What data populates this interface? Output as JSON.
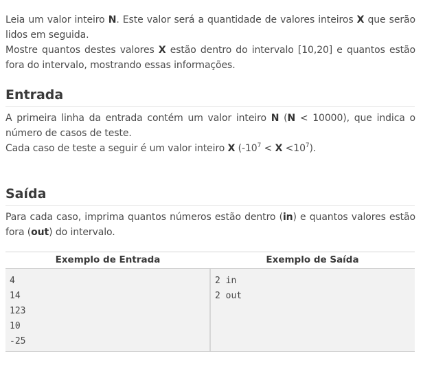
{
  "intro": {
    "p1_a": "Leia um valor inteiro ",
    "p1_b": "N",
    "p1_c": ". Este valor será a quantidade de valores inteiros ",
    "p1_d": "X",
    "p1_e": " que serão lidos em seguida.",
    "p2_a": "Mostre quantos destes valores ",
    "p2_b": "X",
    "p2_c": " estão dentro do intervalo [10,20] e quantos estão fora do intervalo, mostrando essas informações."
  },
  "entrada": {
    "heading": "Entrada",
    "l1_a": "A primeira linha da entrada contém um valor inteiro ",
    "l1_b": "N",
    "l1_c": " (",
    "l1_d": "N",
    "l1_e": " < 10000), que indica o número de casos de teste.",
    "l2_a": "Cada caso de teste a seguir é um valor inteiro ",
    "l2_b": "X",
    "l2_c": " (-10",
    "l2_sup1": "7",
    "l2_d": " < ",
    "l2_e": "X",
    "l2_f": " <10",
    "l2_sup2": "7",
    "l2_g": ")."
  },
  "saida": {
    "heading": "Saída",
    "t_a": "Para cada caso, imprima quantos números estão dentro (",
    "t_b": "in",
    "t_c": ") e quantos valores estão fora (",
    "t_d": "out",
    "t_e": ") do intervalo."
  },
  "examples": {
    "input_header": "Exemplo de Entrada",
    "output_header": "Exemplo de Saída",
    "input_lines": [
      "4",
      "14",
      "123",
      "10",
      "-25"
    ],
    "output_lines": [
      "2 in",
      "2 out"
    ]
  }
}
